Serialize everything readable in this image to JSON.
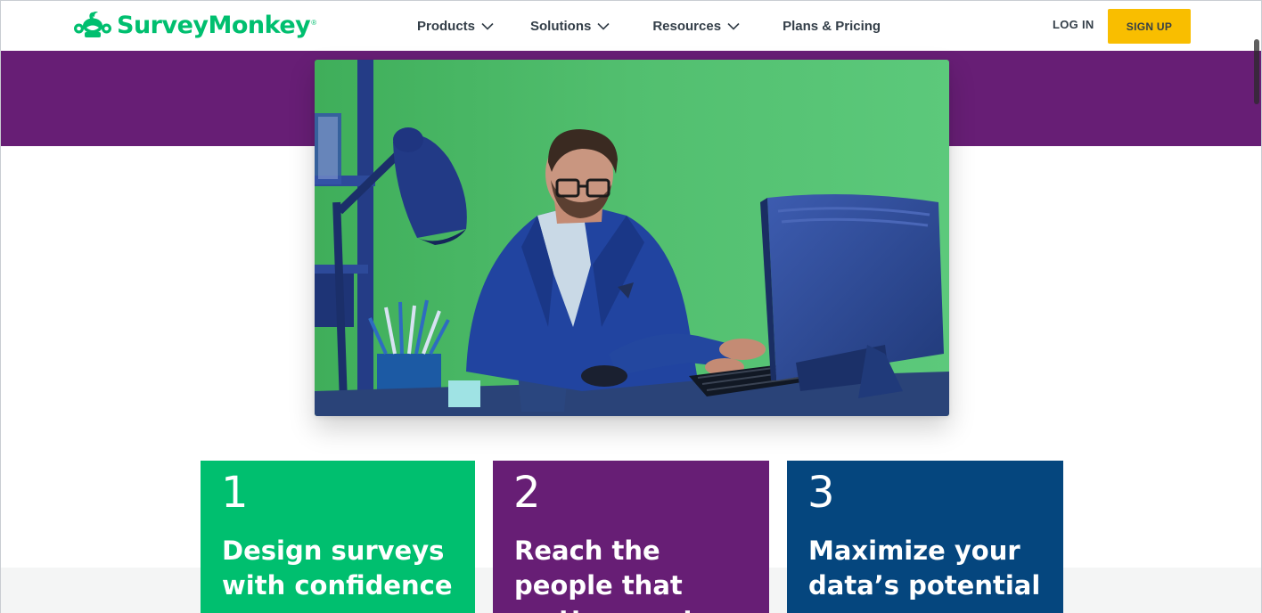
{
  "brand": {
    "name": "SurveyMonkey",
    "trademark": "®",
    "logo_icon": "surveymonkey-logo-icon",
    "color": "#00bf6f"
  },
  "nav": {
    "items": [
      {
        "label": "Products",
        "has_dropdown": true
      },
      {
        "label": "Solutions",
        "has_dropdown": true
      },
      {
        "label": "Resources",
        "has_dropdown": true
      },
      {
        "label": "Plans & Pricing",
        "has_dropdown": false
      }
    ]
  },
  "auth": {
    "login_label": "LOG IN",
    "signup_label": "SIGN UP",
    "signup_color": "#f9be00"
  },
  "hero": {
    "media_type": "video-still",
    "background_color": "#5bc47a"
  },
  "steps": [
    {
      "number": "1",
      "title": "Design surveys with confidence",
      "color": "#00bf6f"
    },
    {
      "number": "2",
      "title": "Reach the people that matter most",
      "color": "#671e75"
    },
    {
      "number": "3",
      "title": "Maximize your data’s potential",
      "color": "#05467e"
    }
  ],
  "colors": {
    "band_purple": "#671e75",
    "text_dark": "#333e48"
  }
}
